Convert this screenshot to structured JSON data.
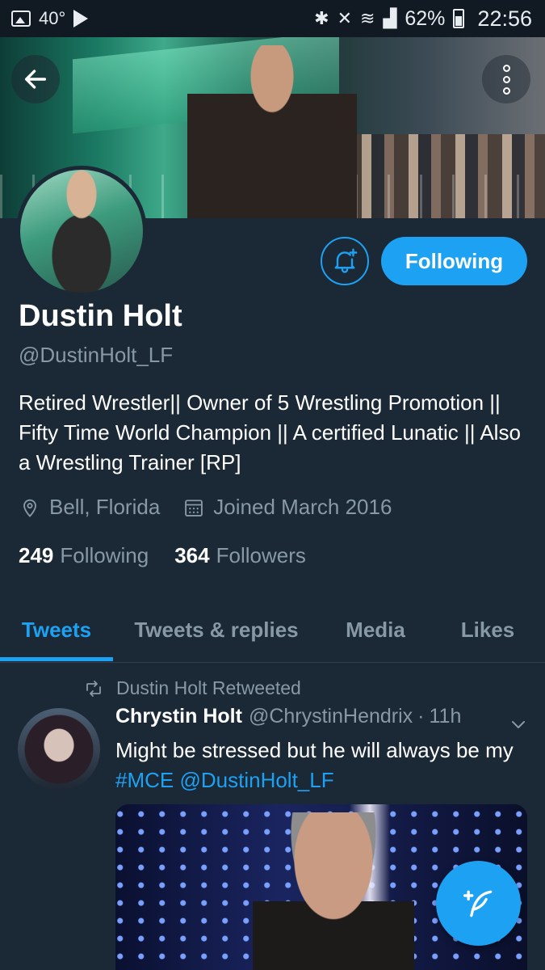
{
  "status_bar": {
    "temperature": "40°",
    "battery_percent": "62%",
    "time": "22:56"
  },
  "profile": {
    "name": "Dustin Holt",
    "handle": "@DustinHolt_LF",
    "bio": "Retired Wrestler|| Owner of 5 Wrestling Promotion || Fifty Time World Champion || A certified Lunatic || Also a Wrestling Trainer [RP]",
    "location": "Bell, Florida",
    "joined": "Joined March 2016",
    "following_count": "249",
    "following_label": "Following",
    "followers_count": "364",
    "followers_label": "Followers",
    "follow_button_label": "Following"
  },
  "tabs": [
    {
      "label": "Tweets",
      "active": true
    },
    {
      "label": "Tweets & replies",
      "active": false
    },
    {
      "label": "Media",
      "active": false
    },
    {
      "label": "Likes",
      "active": false
    }
  ],
  "tweet": {
    "retweet_label": "Dustin Holt Retweeted",
    "author_name": "Chrystin Holt",
    "author_handle": "@ChrystinHendrix",
    "separator": "·",
    "time": "11h",
    "text_before": "Might be stressed but he will always be my ",
    "hashtag": "#MCE",
    "mention": "@DustinHolt_LF"
  },
  "colors": {
    "background": "#1b2836",
    "accent": "#1da1f2",
    "secondary_text": "#8899a6"
  },
  "icons": {
    "back": "arrow-left-icon",
    "more": "more-vertical-icon",
    "notify": "bell-plus-icon",
    "location": "location-pin-icon",
    "calendar": "calendar-icon",
    "retweet": "retweet-icon",
    "caret": "chevron-down-icon",
    "compose": "compose-feather-icon"
  }
}
